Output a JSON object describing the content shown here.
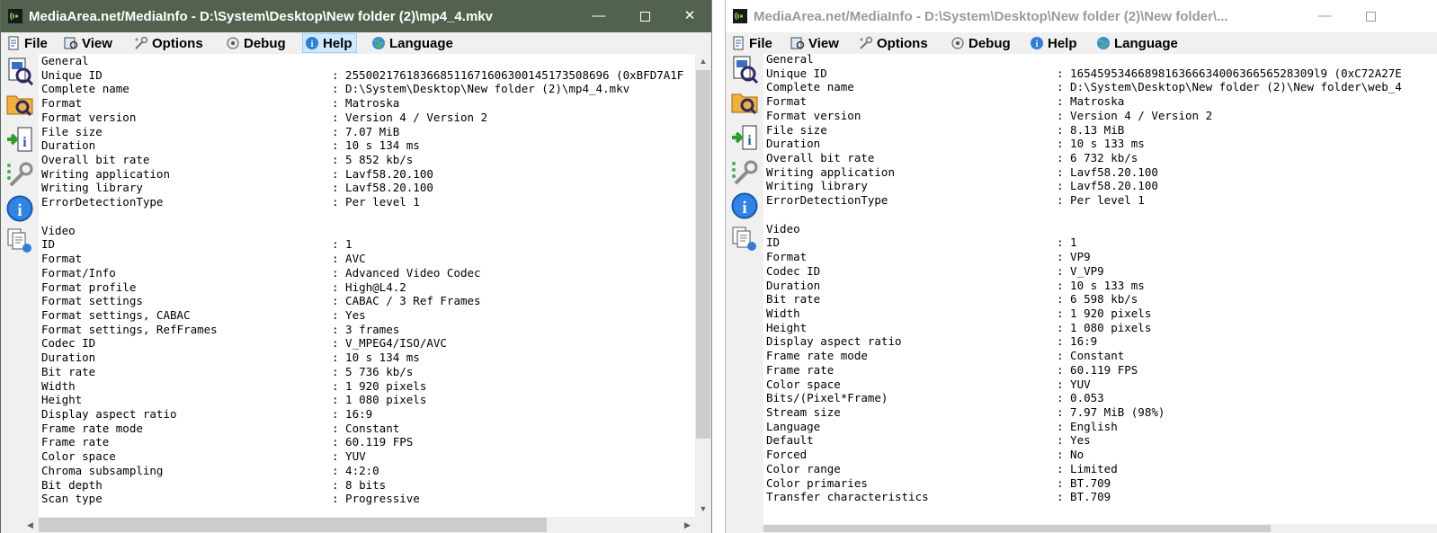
{
  "windows": [
    {
      "title": "MediaArea.net/MediaInfo - D:\\System\\Desktop\\New folder (2)\\mp4_4.mkv",
      "menu": [
        "File",
        "View",
        "Options",
        "Debug",
        "Help",
        "Language"
      ],
      "active_menu": "Help",
      "controls": {
        "minimize": "—",
        "close": "✕"
      },
      "scroll": {
        "up": "▲",
        "down": "▼",
        "left": "◀",
        "right": "▶"
      },
      "lines": [
        {
          "k": "General",
          "v": ""
        },
        {
          "k": "Unique ID",
          "v": ": 255002176183668511671606300145173508696 (0xBFD7A1F"
        },
        {
          "k": "Complete name",
          "v": ": D:\\System\\Desktop\\New folder (2)\\mp4_4.mkv"
        },
        {
          "k": "Format",
          "v": ": Matroska"
        },
        {
          "k": "Format version",
          "v": ": Version 4 / Version 2"
        },
        {
          "k": "File size",
          "v": ": 7.07 MiB"
        },
        {
          "k": "Duration",
          "v": ": 10 s 134 ms"
        },
        {
          "k": "Overall bit rate",
          "v": ": 5 852 kb/s"
        },
        {
          "k": "Writing application",
          "v": ": Lavf58.20.100"
        },
        {
          "k": "Writing library",
          "v": ": Lavf58.20.100"
        },
        {
          "k": "ErrorDetectionType",
          "v": ": Per level 1"
        },
        {
          "k": "",
          "v": ""
        },
        {
          "k": "Video",
          "v": ""
        },
        {
          "k": "ID",
          "v": ": 1"
        },
        {
          "k": "Format",
          "v": ": AVC"
        },
        {
          "k": "Format/Info",
          "v": ": Advanced Video Codec"
        },
        {
          "k": "Format profile",
          "v": ": High@L4.2"
        },
        {
          "k": "Format settings",
          "v": ": CABAC / 3 Ref Frames"
        },
        {
          "k": "Format settings, CABAC",
          "v": ": Yes"
        },
        {
          "k": "Format settings, RefFrames",
          "v": ": 3 frames"
        },
        {
          "k": "Codec ID",
          "v": ": V_MPEG4/ISO/AVC"
        },
        {
          "k": "Duration",
          "v": ": 10 s 134 ms"
        },
        {
          "k": "Bit rate",
          "v": ": 5 736 kb/s"
        },
        {
          "k": "Width",
          "v": ": 1 920 pixels"
        },
        {
          "k": "Height",
          "v": ": 1 080 pixels"
        },
        {
          "k": "Display aspect ratio",
          "v": ": 16:9"
        },
        {
          "k": "Frame rate mode",
          "v": ": Constant"
        },
        {
          "k": "Frame rate",
          "v": ": 60.119 FPS"
        },
        {
          "k": "Color space",
          "v": ": YUV"
        },
        {
          "k": "Chroma subsampling",
          "v": ": 4:2:0"
        },
        {
          "k": "Bit depth",
          "v": ": 8 bits"
        },
        {
          "k": "Scan type",
          "v": ": Progressive"
        }
      ]
    },
    {
      "title": "MediaArea.net/MediaInfo - D:\\System\\Desktop\\New folder (2)\\New folder\\...",
      "menu": [
        "File",
        "View",
        "Options",
        "Debug",
        "Help",
        "Language"
      ],
      "active_menu": "",
      "controls": {
        "minimize": "—",
        "close": "✕"
      },
      "scroll": {
        "up": "▲",
        "down": "▼",
        "left": "◀",
        "right": "▶"
      },
      "lines": [
        {
          "k": "General",
          "v": ""
        },
        {
          "k": "Unique ID",
          "v": ": 165459534668981636663400636656528309l9 (0xC72A27E"
        },
        {
          "k": "Complete name",
          "v": ": D:\\System\\Desktop\\New folder (2)\\New folder\\web_4"
        },
        {
          "k": "Format",
          "v": ": Matroska"
        },
        {
          "k": "Format version",
          "v": ": Version 4 / Version 2"
        },
        {
          "k": "File size",
          "v": ": 8.13 MiB"
        },
        {
          "k": "Duration",
          "v": ": 10 s 133 ms"
        },
        {
          "k": "Overall bit rate",
          "v": ": 6 732 kb/s"
        },
        {
          "k": "Writing application",
          "v": ": Lavf58.20.100"
        },
        {
          "k": "Writing library",
          "v": ": Lavf58.20.100"
        },
        {
          "k": "ErrorDetectionType",
          "v": ": Per level 1"
        },
        {
          "k": "",
          "v": ""
        },
        {
          "k": "Video",
          "v": ""
        },
        {
          "k": "ID",
          "v": ": 1"
        },
        {
          "k": "Format",
          "v": ": VP9"
        },
        {
          "k": "Codec ID",
          "v": ": V_VP9"
        },
        {
          "k": "Duration",
          "v": ": 10 s 133 ms"
        },
        {
          "k": "Bit rate",
          "v": ": 6 598 kb/s"
        },
        {
          "k": "Width",
          "v": ": 1 920 pixels"
        },
        {
          "k": "Height",
          "v": ": 1 080 pixels"
        },
        {
          "k": "Display aspect ratio",
          "v": ": 16:9"
        },
        {
          "k": "Frame rate mode",
          "v": ": Constant"
        },
        {
          "k": "Frame rate",
          "v": ": 60.119 FPS"
        },
        {
          "k": "Color space",
          "v": ": YUV"
        },
        {
          "k": "Bits/(Pixel*Frame)",
          "v": ": 0.053"
        },
        {
          "k": "Stream size",
          "v": ": 7.97 MiB (98%)"
        },
        {
          "k": "Language",
          "v": ": English"
        },
        {
          "k": "Default",
          "v": ": Yes"
        },
        {
          "k": "Forced",
          "v": ": No"
        },
        {
          "k": "Color range",
          "v": ": Limited"
        },
        {
          "k": "Color primaries",
          "v": ": BT.709"
        },
        {
          "k": "Transfer characteristics",
          "v": ": BT.709"
        }
      ]
    }
  ],
  "colors": {
    "active_title_bg": "#52624f",
    "inactive_title_text": "#9a9a9a",
    "menu_highlight": "#cde8ff"
  },
  "icons": [
    "mediainfo-app-icon",
    "file-menu-icon",
    "view-menu-icon",
    "options-menu-icon",
    "debug-menu-icon",
    "help-menu-icon",
    "language-menu-icon",
    "open-file-icon",
    "open-folder-icon",
    "export-icon",
    "preferences-icon",
    "about-icon",
    "view-mode-icon"
  ]
}
